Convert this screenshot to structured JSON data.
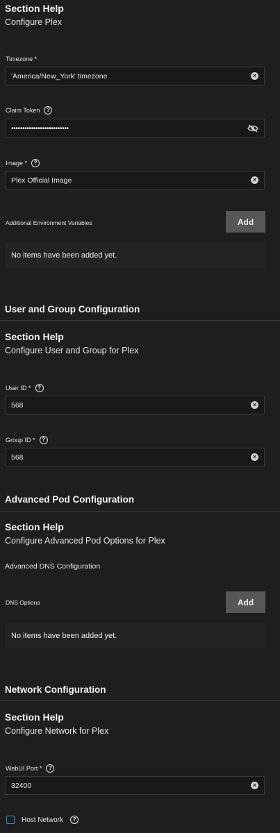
{
  "configure_plex": {
    "help_title": "Section Help",
    "help_text": "Configure Plex",
    "timezone": {
      "label": "Timezone *",
      "value": "'America/New_York' timezone"
    },
    "claim_token": {
      "label": "Claim Token",
      "value": "••••••••••••••••••••••••••"
    },
    "image": {
      "label": "Image *",
      "value": "Plex Official Image"
    },
    "env_vars": {
      "label": "Additional Environment Variables",
      "add_label": "Add",
      "empty_text": "No items have been added yet."
    }
  },
  "user_group": {
    "title": "User and Group Configuration",
    "help_title": "Section Help",
    "help_text": "Configure User and Group for Plex",
    "user_id": {
      "label": "User ID *",
      "value": "568"
    },
    "group_id": {
      "label": "Group ID *",
      "value": "568"
    }
  },
  "advanced_pod": {
    "title": "Advanced Pod Configuration",
    "help_title": "Section Help",
    "help_text": "Configure Advanced Pod Options for Plex",
    "dns_config_label": "Advanced DNS Configuration",
    "dns_options": {
      "label": "DNS Options",
      "add_label": "Add",
      "empty_text": "No items have been added yet."
    }
  },
  "network": {
    "title": "Network Configuration",
    "help_title": "Section Help",
    "help_text": "Configure Network for Plex",
    "webui_port": {
      "label": "WebUI Port *",
      "value": "32400"
    },
    "host_network": {
      "label": "Host Network",
      "checked": false
    }
  },
  "icons": {
    "help": "question-circle-icon",
    "clear": "clear-circle-icon",
    "visibility": "eye-off-icon"
  },
  "colors": {
    "background": "#1e1e1e",
    "field_background": "#181818",
    "button_background": "#575757",
    "checkbox_border": "#4a8ab0"
  }
}
